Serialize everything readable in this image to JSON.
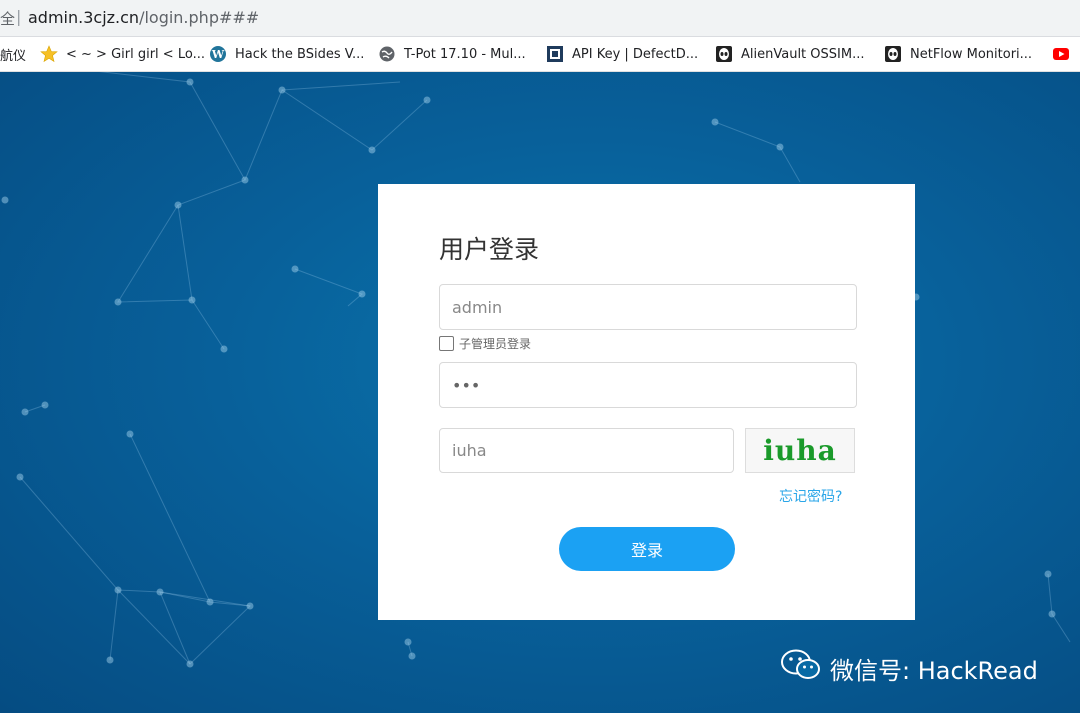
{
  "browser": {
    "secure_label": "全",
    "url_host": "admin.3cjz.cn",
    "url_path": "/login.php###"
  },
  "bookmarks": [
    {
      "label": "航仪",
      "icon": "none"
    },
    {
      "label": "< ~ > Girl girl < Lo...",
      "icon": "star-icon"
    },
    {
      "label": "Hack the BSides V...",
      "icon": "wordpress-icon"
    },
    {
      "label": "T-Pot 17.10 - Mul...",
      "icon": "globe-icon"
    },
    {
      "label": "API Key | DefectD...",
      "icon": "defectdojo-icon"
    },
    {
      "label": "AlienVault OSSIM...",
      "icon": "alien-icon"
    },
    {
      "label": "NetFlow Monitori...",
      "icon": "alien-icon"
    },
    {
      "label": "",
      "icon": "youtube-icon"
    }
  ],
  "login": {
    "title": "用户登录",
    "username_placeholder": "admin",
    "sub_admin_label": "子管理员登录",
    "password_value": "•••",
    "captcha_placeholder": "iuha",
    "captcha_image_text": "iuha",
    "forgot_label": "忘记密码?",
    "submit_label": "登录"
  },
  "watermark": {
    "text": "微信号: HackRead"
  },
  "colors": {
    "background": "#08609a",
    "button": "#1ba1f3",
    "link": "#2aa6e8",
    "captcha": "#1a9a2a"
  }
}
